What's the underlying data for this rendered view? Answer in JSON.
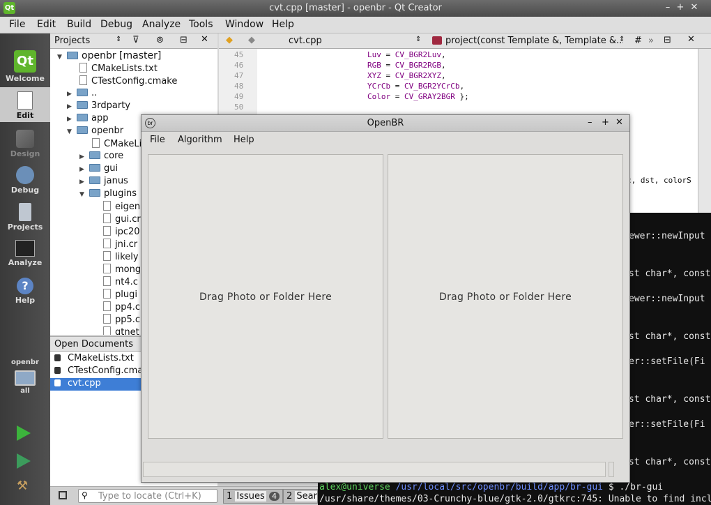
{
  "window": {
    "title": "cvt.cpp [master] - openbr - Qt Creator",
    "logo": "Qt"
  },
  "menubar": [
    "File",
    "Edit",
    "Build",
    "Debug",
    "Analyze",
    "Tools",
    "Window",
    "Help"
  ],
  "modes": [
    {
      "label": "Welcome",
      "icon": "qt-logo-icon"
    },
    {
      "label": "Edit",
      "icon": "document-icon"
    },
    {
      "label": "Design",
      "icon": "design-icon"
    },
    {
      "label": "Debug",
      "icon": "debug-icon"
    },
    {
      "label": "Projects",
      "icon": "projects-icon"
    },
    {
      "label": "Analyze",
      "icon": "analyze-icon"
    },
    {
      "label": "Help",
      "icon": "help-icon"
    }
  ],
  "kit": {
    "project": "openbr",
    "config": "all"
  },
  "projects_pane": {
    "title": "Projects",
    "tree": [
      {
        "label": "openbr [master]",
        "type": "folder",
        "expanded": true,
        "depth": 0
      },
      {
        "label": "CMakeLists.txt",
        "type": "file",
        "depth": 1
      },
      {
        "label": "CTestConfig.cmake",
        "type": "file",
        "depth": 1
      },
      {
        "label": "..",
        "type": "folder",
        "expanded": false,
        "depth": 1
      },
      {
        "label": "3rdparty",
        "type": "folder",
        "expanded": false,
        "depth": 1
      },
      {
        "label": "app",
        "type": "folder",
        "expanded": false,
        "depth": 1
      },
      {
        "label": "openbr",
        "type": "folder",
        "expanded": true,
        "depth": 1
      },
      {
        "label": "CMakeLi",
        "type": "file",
        "depth": 2
      },
      {
        "label": "core",
        "type": "folder",
        "expanded": false,
        "depth": 2
      },
      {
        "label": "gui",
        "type": "folder",
        "expanded": false,
        "depth": 2
      },
      {
        "label": "janus",
        "type": "folder",
        "expanded": false,
        "depth": 2
      },
      {
        "label": "plugins",
        "type": "folder",
        "expanded": true,
        "depth": 2
      },
      {
        "label": "eigen",
        "type": "file",
        "depth": 3
      },
      {
        "label": "gui.cr",
        "type": "file",
        "depth": 3
      },
      {
        "label": "ipc20",
        "type": "file",
        "depth": 3
      },
      {
        "label": "jni.cr",
        "type": "file",
        "depth": 3
      },
      {
        "label": "likely",
        "type": "file",
        "depth": 3
      },
      {
        "label": "mong",
        "type": "file",
        "depth": 3
      },
      {
        "label": "nt4.c",
        "type": "file",
        "depth": 3
      },
      {
        "label": "plugi",
        "type": "file",
        "depth": 3
      },
      {
        "label": "pp4.c",
        "type": "file",
        "depth": 3
      },
      {
        "label": "pp5.c",
        "type": "file",
        "depth": 3
      },
      {
        "label": "qtnet",
        "type": "file",
        "depth": 3
      }
    ]
  },
  "open_documents": {
    "title": "Open Documents",
    "items": [
      {
        "label": "CMakeLists.txt",
        "selected": false
      },
      {
        "label": "CTestConfig.cma",
        "selected": false
      },
      {
        "label": "cvt.cpp",
        "selected": true
      }
    ]
  },
  "editor": {
    "file": "cvt.cpp",
    "symbol": "project(const Template &, Template &...",
    "hash": "#",
    "lines": [
      {
        "num": "45",
        "name": "Luv",
        "value": "CV_BGR2Luv",
        "tail": ","
      },
      {
        "num": "46",
        "name": "RGB",
        "value": "CV_BGR2RGB",
        "tail": ","
      },
      {
        "num": "47",
        "name": "XYZ",
        "value": "CV_BGR2XYZ",
        "tail": ","
      },
      {
        "num": "48",
        "name": "YCrCb",
        "value": "CV_BGR2YCrCb",
        "tail": ","
      },
      {
        "num": "49",
        "name": "Color",
        "value": "CV_GRAY2BGR",
        "tail": " };"
      },
      {
        "num": "50",
        "name": "",
        "value": "",
        "tail": ""
      }
    ],
    "partial_right": "c, dst, colorS"
  },
  "terminal": {
    "right_lines": [
      "ewer::newInput",
      "st char*, const",
      "ewer::newInput",
      "st char*, const",
      "er::setFile(Fi",
      "st char*, const",
      "er::setFile(Fi",
      "st char*, const"
    ],
    "prompt_user": "alex@universe",
    "prompt_path": "/usr/local/src/openbr/build/app/br-gui",
    "prompt_cmd": "$ ./br-gui",
    "warning": "/usr/share/themes/03-Crunchy-blue/gtk-2.0/gtkrc:745: Unable to find include"
  },
  "locator": {
    "placeholder": "Type to locate (Ctrl+K)"
  },
  "output_tabs": [
    {
      "num": "1",
      "label": "Issues",
      "badge": "4"
    },
    {
      "num": "2",
      "label": "Sear"
    }
  ],
  "dialog": {
    "title": "OpenBR",
    "menu": [
      "File",
      "Algorithm",
      "Help"
    ],
    "left_panel": "Drag Photo or Folder Here",
    "right_panel": "Drag Photo or Folder Here",
    "window_controls": [
      "–",
      "+",
      "✕"
    ]
  }
}
